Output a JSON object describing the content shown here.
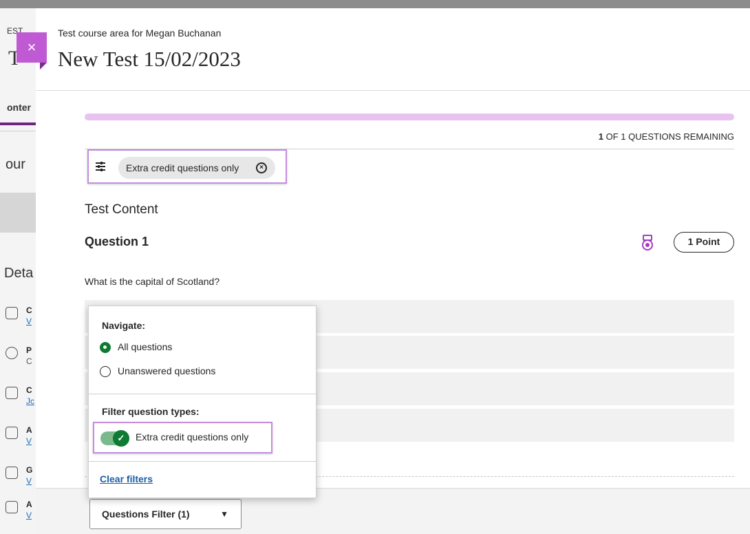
{
  "background": {
    "fragments": {
      "est": "EST",
      "t": "T",
      "onter": "onter",
      "cour": "our",
      "deta": "Deta"
    },
    "rows": [
      {
        "l1": "C",
        "l2": "V"
      },
      {
        "l1": "P",
        "l2": "C"
      },
      {
        "l1": "C",
        "l2": "Jc"
      },
      {
        "l1": "A",
        "l2": "V"
      },
      {
        "l1": "G",
        "l2": "V"
      },
      {
        "l1": "A",
        "l2": "V"
      }
    ]
  },
  "header": {
    "close_glyph": "×",
    "breadcrumb": "Test course area for Megan Buchanan",
    "title": "New Test 15/02/2023"
  },
  "progress": {
    "remaining_count": "1",
    "remaining_suffix": " OF 1 QUESTIONS REMAINING",
    "fraction_complete": 0.0,
    "bar_color": "#e9c3f0"
  },
  "filter_chip": {
    "label": "Extra credit questions only",
    "remove_glyph": "×"
  },
  "test": {
    "section_title": "Test Content",
    "question_title": "Question 1",
    "points": "1 Point",
    "question_text": "What is the capital of Scotland?",
    "answer_count": 4
  },
  "popover": {
    "navigate_heading": "Navigate:",
    "options": [
      "All questions",
      "Unanswered questions"
    ],
    "selected_option": "All questions",
    "filter_heading": "Filter question types:",
    "toggle_label": "Extra credit questions only",
    "toggle_on": true,
    "clear_label": "Clear filters"
  },
  "footer": {
    "select_label": "Questions Filter (1)",
    "caret": "▼"
  },
  "colors": {
    "accent_purple": "#c05ad4",
    "highlight_border": "#c48de0",
    "toggle_green": "#0e7a32",
    "link_blue": "#1a5ea8"
  },
  "icons": {
    "close": "close-icon",
    "filter": "filter-sliders-icon",
    "chip_remove": "circle-x-icon",
    "extra_credit": "medal-icon",
    "caret": "caret-down-icon",
    "check": "check-icon"
  }
}
